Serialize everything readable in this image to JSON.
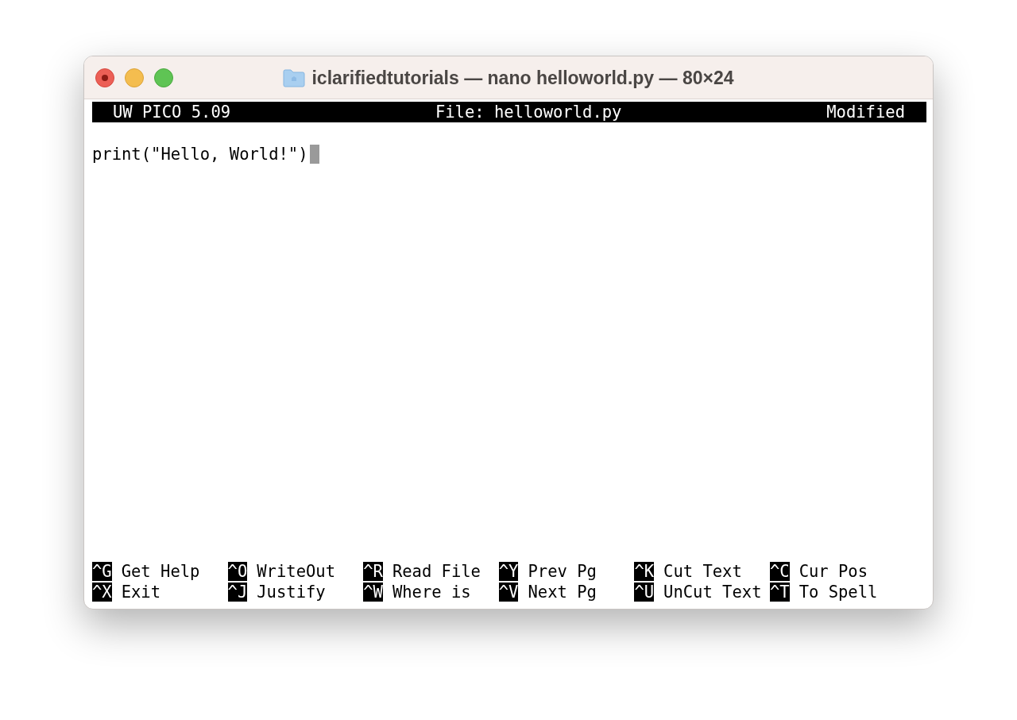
{
  "window": {
    "title": "iclarifiedtutorials — nano helloworld.py — 80×24"
  },
  "header": {
    "app": "UW PICO 5.09",
    "file": "File: helloworld.py",
    "status": "Modified"
  },
  "lines": [
    "print(\"Hello, World!\")"
  ],
  "cursor": true,
  "shortcuts": [
    [
      {
        "key": "^G",
        "label": "Get Help"
      },
      {
        "key": "^O",
        "label": "WriteOut"
      },
      {
        "key": "^R",
        "label": "Read File"
      },
      {
        "key": "^Y",
        "label": "Prev Pg"
      },
      {
        "key": "^K",
        "label": "Cut Text"
      },
      {
        "key": "^C",
        "label": "Cur Pos"
      }
    ],
    [
      {
        "key": "^X",
        "label": "Exit"
      },
      {
        "key": "^J",
        "label": "Justify"
      },
      {
        "key": "^W",
        "label": "Where is"
      },
      {
        "key": "^V",
        "label": "Next Pg"
      },
      {
        "key": "^U",
        "label": "UnCut Text"
      },
      {
        "key": "^T",
        "label": "To Spell"
      }
    ]
  ]
}
